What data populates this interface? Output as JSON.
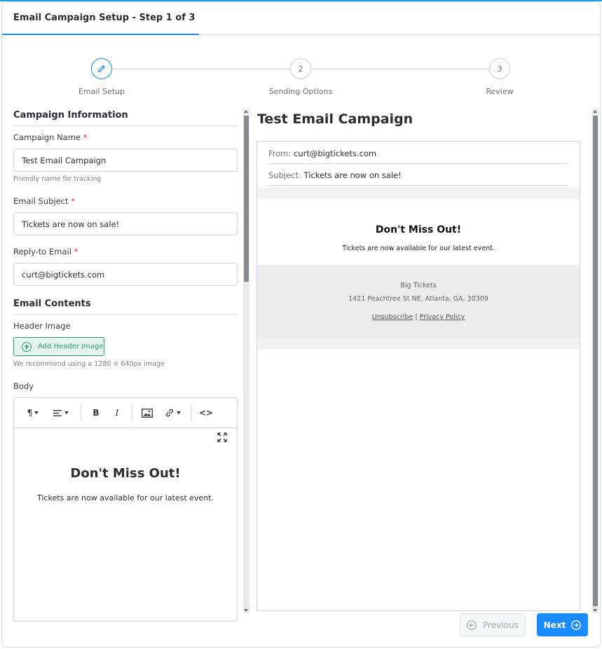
{
  "header": {
    "title": "Email Campaign Setup - Step 1 of 3"
  },
  "stepper": {
    "steps": [
      {
        "number": "",
        "label": "Email Setup",
        "active": true,
        "icon": "pencil-icon"
      },
      {
        "number": "2",
        "label": "Sending Options",
        "active": false
      },
      {
        "number": "3",
        "label": "Review",
        "active": false
      }
    ]
  },
  "form": {
    "campaign_info_title": "Campaign Information",
    "campaign_name_label": "Campaign Name",
    "campaign_name_value": "Test Email Campaign",
    "campaign_name_hint": "Friendly name for tracking",
    "email_subject_label": "Email Subject",
    "email_subject_value": "Tickets are now on sale!",
    "reply_to_label": "Reply-to Email",
    "reply_to_value": "curt@bigtickets.com",
    "required_mark": "*",
    "email_contents_title": "Email Contents",
    "header_image_label": "Header Image",
    "add_header_image_button": "Add Header Image",
    "header_image_hint": "We recommend using a 1280 × 640px image",
    "body_label": "Body"
  },
  "editor": {
    "toolbar": {
      "paragraph": "¶",
      "bold": "B",
      "italic": "I",
      "code": "<>"
    },
    "heading": "Don't Miss Out!",
    "paragraph": "Tickets are now available for our latest event."
  },
  "preview": {
    "title": "Test Email Campaign",
    "from_label": "From:",
    "from_value": "curt@bigtickets.com",
    "subject_label": "Subject:",
    "subject_value": "Tickets are now on sale!",
    "heading": "Don't Miss Out!",
    "paragraph": "Tickets are now available for our latest event.",
    "footer_company": "Big Tickets",
    "footer_address": "1421 Peachtree St NE, Atlanta, GA, 30309",
    "unsubscribe": "Unsubscribe",
    "separator": "|",
    "privacy": "Privacy Policy"
  },
  "buttons": {
    "previous": "Previous",
    "next": "Next"
  },
  "colors": {
    "accent": "#1e88e5",
    "next_button": "#1a8cff",
    "add_image_green": "#2e9c72",
    "required_red": "#e0343d"
  }
}
